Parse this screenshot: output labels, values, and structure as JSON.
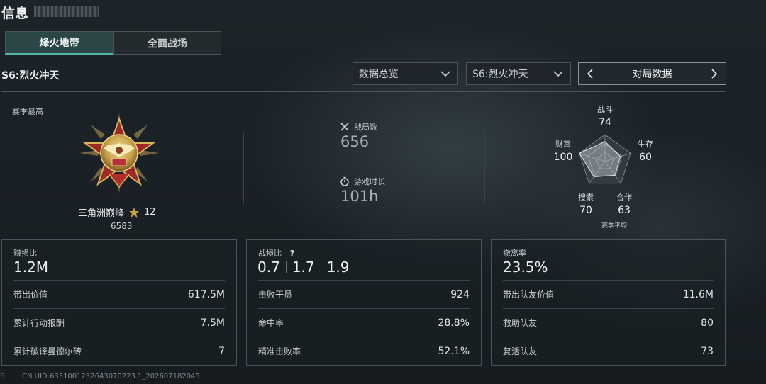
{
  "header": {
    "title": "信息"
  },
  "tabs": [
    {
      "label": "烽火地带",
      "active": true
    },
    {
      "label": "全面战场",
      "active": false
    }
  ],
  "season": {
    "name": "S6:烈火冲天"
  },
  "filters": {
    "view_select": "数据总览",
    "season_select": "S6:烈火冲天",
    "pager_label": "对局数据"
  },
  "season_best": {
    "label": "赛季最高",
    "rank_name": "三角洲巅峰",
    "stars": "12",
    "score": "6583"
  },
  "overview": {
    "battles_label": "战局数",
    "battles_value": "656",
    "time_label": "游戏时长",
    "time_value": "101h"
  },
  "radar": {
    "legend": "赛季平均",
    "axes": [
      {
        "label": "战斗",
        "value": "74",
        "score": 74
      },
      {
        "label": "生存",
        "value": "60",
        "score": 60
      },
      {
        "label": "合作",
        "value": "63",
        "score": 63
      },
      {
        "label": "搜索",
        "value": "70",
        "score": 70
      },
      {
        "label": "财富",
        "value": "100",
        "score": 100
      }
    ]
  },
  "panels": {
    "profit": {
      "title": "赚损比",
      "value": "1.2M",
      "rows": [
        {
          "label": "带出价值",
          "value": "617.5M"
        },
        {
          "label": "累计行动报酬",
          "value": "7.5M"
        },
        {
          "label": "累计破译曼德尔砖",
          "value": "7"
        }
      ]
    },
    "combat": {
      "title": "战损比",
      "help_icon": "?",
      "ratios": [
        "0.7",
        "1.7",
        "1.9"
      ],
      "rows": [
        {
          "label": "击败干员",
          "value": "924"
        },
        {
          "label": "命中率",
          "value": "28.8%"
        },
        {
          "label": "精准击败率",
          "value": "52.1%"
        }
      ]
    },
    "extract": {
      "title": "撤离率",
      "value": "23.5%",
      "rows": [
        {
          "label": "带出队友价值",
          "value": "11.6M"
        },
        {
          "label": "救助队友",
          "value": "80"
        },
        {
          "label": "复活队友",
          "value": "73"
        }
      ]
    }
  },
  "footer": {
    "left_mark": "6",
    "uid": "CN UID:6331001232643070223 1_202607182045"
  },
  "colors": {
    "accent": "#4fb6a8",
    "gold": "#c8a24a",
    "medal_red": "#9b2a26"
  }
}
